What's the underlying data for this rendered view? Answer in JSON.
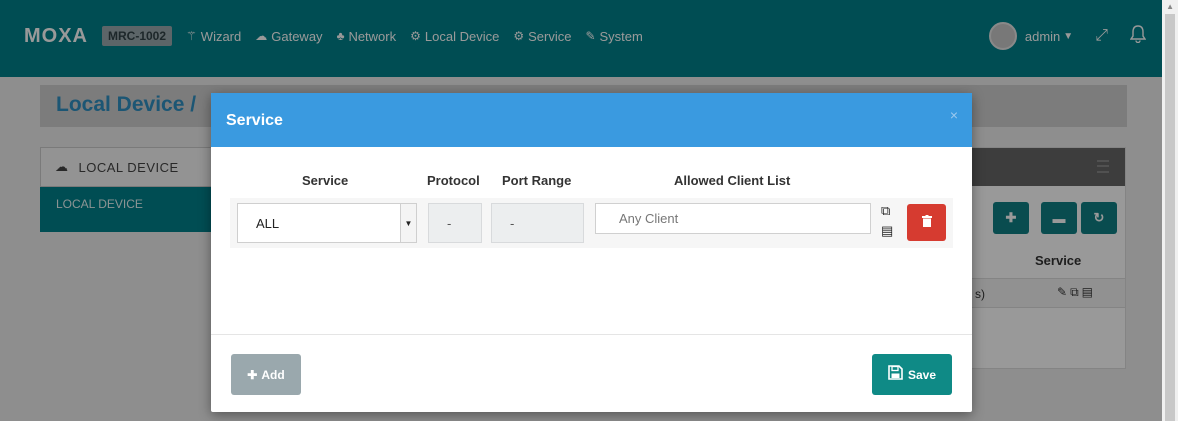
{
  "topbar": {
    "logo": "MOXA",
    "model": "MRC-1002",
    "nav": [
      {
        "label": "Wizard",
        "icon": "magic-wand-icon",
        "glyph": "⚚"
      },
      {
        "label": "Gateway",
        "icon": "cloud-icon",
        "glyph": "☁"
      },
      {
        "label": "Network",
        "icon": "sitemap-icon",
        "glyph": "♣"
      },
      {
        "label": "Local Device",
        "icon": "gear-icon",
        "glyph": "⚙"
      },
      {
        "label": "Service",
        "icon": "gears-icon",
        "glyph": "⚙"
      },
      {
        "label": "System",
        "icon": "wrench-icon",
        "glyph": "✎"
      }
    ],
    "user": "admin"
  },
  "page": {
    "title": "Local Device /",
    "left_panel": {
      "header": "LOCAL DEVICE",
      "active_item": "LOCAL DEVICE"
    },
    "right_panel": {
      "column_header": "Service",
      "row_text": "s)"
    }
  },
  "modal": {
    "title": "Service",
    "close": "×",
    "columns": {
      "service": "Service",
      "protocol": "Protocol",
      "port_range": "Port Range",
      "allowed_clients": "Allowed Client List"
    },
    "row": {
      "service_value": "ALL",
      "protocol_value": "-",
      "port_range_value": "-",
      "client_placeholder": "Any Client"
    },
    "add_label": "Add",
    "save_label": "Save"
  },
  "colors": {
    "topbar": "#00818a",
    "modal_header": "#3a9ae0",
    "delete": "#d63b30",
    "save": "#0f8a86",
    "add_disabled": "#9aa8ad"
  }
}
